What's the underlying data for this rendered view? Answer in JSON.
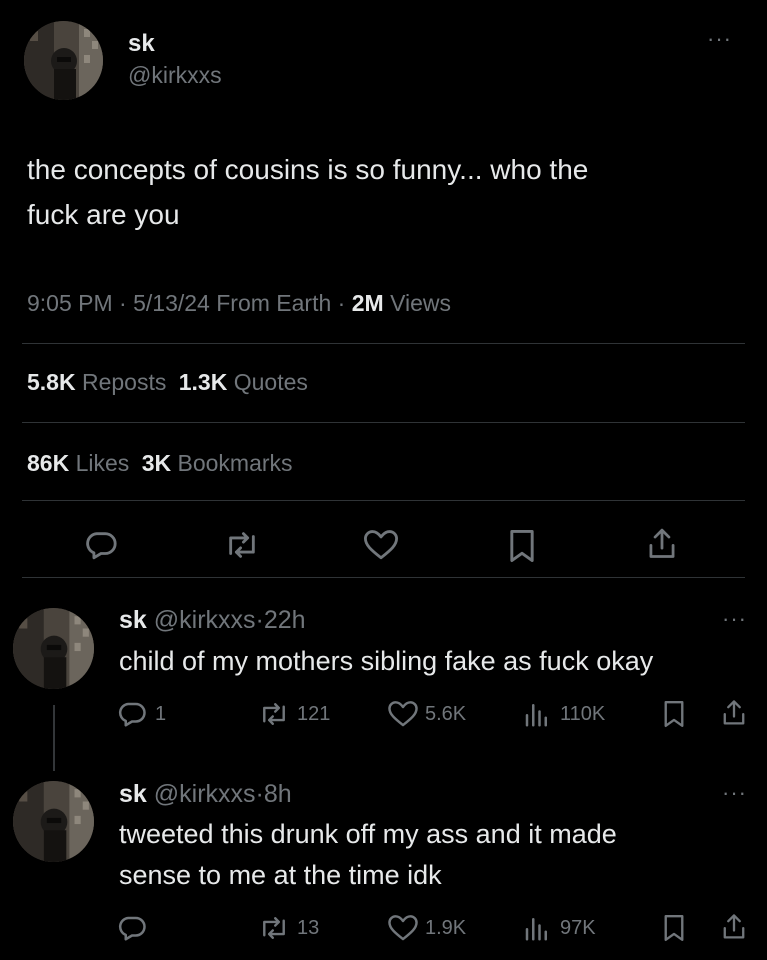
{
  "main_tweet": {
    "display_name": "sk",
    "handle": "@kirkxxs",
    "text_line1": "the concepts of cousins is so funny... who the",
    "text_line2": "fuck are you",
    "time": "9:05 PM",
    "date": "5/13/24",
    "source": "From Earth",
    "views_count": "2M",
    "views_label": "Views",
    "reposts_count": "5.8K",
    "reposts_label": "Reposts",
    "quotes_count": "1.3K",
    "quotes_label": "Quotes",
    "likes_count": "86K",
    "likes_label": "Likes",
    "bookmarks_count": "3K",
    "bookmarks_label": "Bookmarks",
    "separator": "·"
  },
  "replies": [
    {
      "display_name": "sk",
      "handle": "@kirkxxs",
      "age": "22h",
      "text_line1": "child of my mothers sibling fake as fuck okay",
      "text_line2": "",
      "reply_count": "1",
      "repost_count": "121",
      "like_count": "5.6K",
      "view_count": "110K"
    },
    {
      "display_name": "sk",
      "handle": "@kirkxxs",
      "age": "8h",
      "text_line1": "tweeted this drunk off my ass and it made",
      "text_line2": "sense to me at the time idk",
      "reply_count": "",
      "repost_count": "13",
      "like_count": "1.9K",
      "view_count": "97K"
    }
  ],
  "more_glyph": "···",
  "colors": {
    "background": "#000000",
    "text": "#e7e9ea",
    "muted": "#71767b",
    "divider": "#2f3336"
  },
  "icons": [
    "more-icon",
    "reply-icon",
    "repost-icon",
    "like-icon",
    "bookmark-icon",
    "share-icon",
    "views-icon"
  ]
}
